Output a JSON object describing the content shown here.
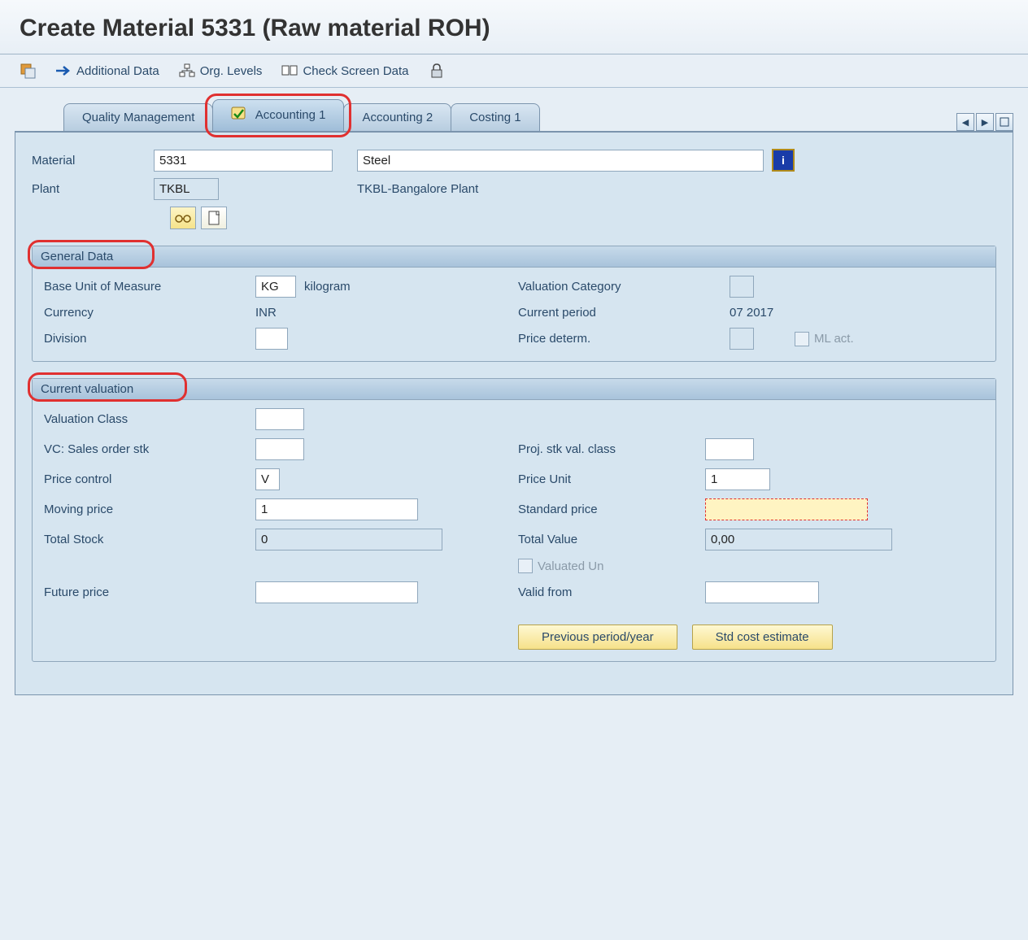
{
  "title": "Create Material 5331 (Raw material ROH)",
  "toolbar": {
    "additional_data": "Additional Data",
    "org_levels": "Org. Levels",
    "check_screen": "Check Screen Data"
  },
  "tabs": {
    "quality": "Quality Management",
    "accounting1": "Accounting 1",
    "accounting2": "Accounting 2",
    "costing1": "Costing 1"
  },
  "header": {
    "material_label": "Material",
    "material_value": "5331",
    "material_desc": "Steel",
    "plant_label": "Plant",
    "plant_value": "TKBL",
    "plant_desc": "TKBL-Bangalore Plant"
  },
  "general_data": {
    "section_title": "General Data",
    "base_uom_label": "Base Unit of Measure",
    "base_uom_value": "KG",
    "base_uom_text": "kilogram",
    "valuation_category_label": "Valuation Category",
    "valuation_category_value": "",
    "currency_label": "Currency",
    "currency_value": "INR",
    "current_period_label": "Current period",
    "current_period_value": "07 2017",
    "division_label": "Division",
    "division_value": "",
    "price_determ_label": "Price determ.",
    "price_determ_value": "",
    "ml_act_label": "ML act."
  },
  "current_valuation": {
    "section_title": "Current valuation",
    "valuation_class_label": "Valuation Class",
    "valuation_class_value": "",
    "vc_sales_label": "VC: Sales order stk",
    "vc_sales_value": "",
    "proj_stk_label": "Proj. stk val. class",
    "proj_stk_value": "",
    "price_control_label": "Price control",
    "price_control_value": "V",
    "price_unit_label": "Price Unit",
    "price_unit_value": "1",
    "moving_price_label": "Moving price",
    "moving_price_value": "1",
    "standard_price_label": "Standard price",
    "standard_price_value": "",
    "total_stock_label": "Total Stock",
    "total_stock_value": "0",
    "total_value_label": "Total Value",
    "total_value_value": "0,00",
    "valuated_un_label": "Valuated Un",
    "future_price_label": "Future price",
    "future_price_value": "",
    "valid_from_label": "Valid from",
    "valid_from_value": "",
    "btn_prev_period": "Previous period/year",
    "btn_std_cost": "Std cost estimate"
  }
}
